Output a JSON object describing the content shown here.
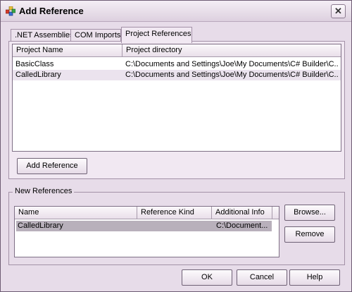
{
  "window": {
    "title": "Add Reference",
    "close_glyph": "✕"
  },
  "tabs": [
    ".NET Assemblies",
    "COM Imports",
    "Project References"
  ],
  "project_list": {
    "columns": [
      "Project Name",
      "Project directory"
    ],
    "rows": [
      {
        "name": "BasicClass",
        "dir": "C:\\Documents and Settings\\Joe\\My Documents\\C# Builder\\C..."
      },
      {
        "name": "CalledLibrary",
        "dir": "C:\\Documents and Settings\\Joe\\My Documents\\C# Builder\\C..."
      }
    ]
  },
  "add_reference_label": "Add Reference",
  "new_refs": {
    "group_label": "New References",
    "columns": [
      "Name",
      "Reference Kind",
      "Additional Info"
    ],
    "rows": [
      {
        "name": "CalledLibrary",
        "kind": "",
        "info": "C:\\Document..."
      }
    ]
  },
  "browse_label": "Browse...",
  "remove_label": "Remove",
  "footer": {
    "ok": "OK",
    "cancel": "Cancel",
    "help": "Help"
  }
}
